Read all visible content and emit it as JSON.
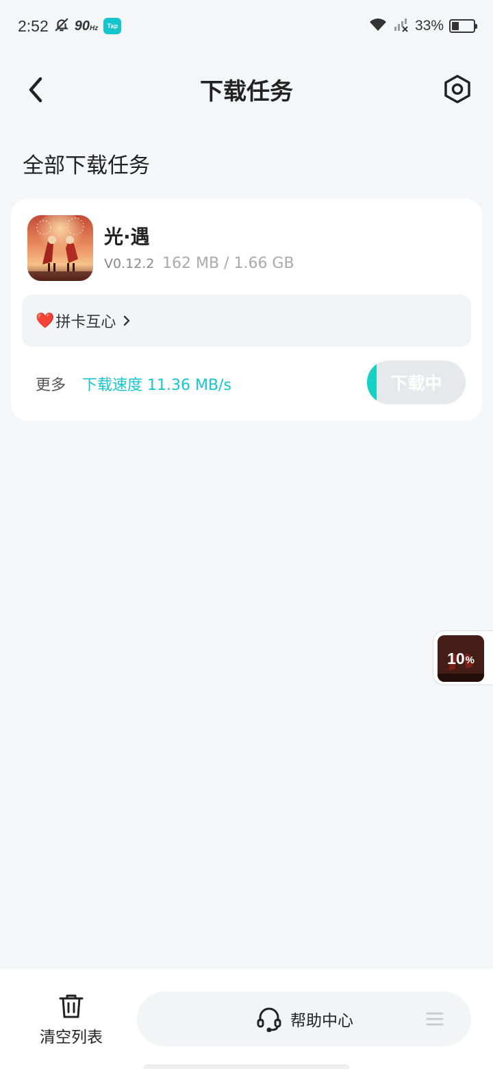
{
  "status_bar": {
    "time": "2:52",
    "refresh_rate": "90",
    "refresh_unit": "Hz",
    "tap_badge": "Tap",
    "battery_percent": "33%",
    "battery_level": 0.33,
    "icons": [
      "mute-bell-icon",
      "wifi-icon",
      "signal-off-icon",
      "battery-icon"
    ]
  },
  "header": {
    "title": "下载任务",
    "back_icon": "chevron-left-icon",
    "settings_icon": "settings-hexagon-icon"
  },
  "section_title": "全部下载任务",
  "task": {
    "app_name": "光·遇",
    "version": "V0.12.2",
    "size_progress": "162 MB / 1.66 GB",
    "promo": {
      "emoji": "❤️",
      "text": "拼卡互心"
    },
    "more_label": "更多",
    "speed_label": "下载速度 11.36 MB/s",
    "button_label": "下载中",
    "progress_fraction": 0.0976
  },
  "float_widget": {
    "percent_value": "10",
    "percent_sign": "%"
  },
  "bottom_bar": {
    "clear_label": "清空列表",
    "help_label": "帮助中心",
    "icons": [
      "trash-icon",
      "headset-icon",
      "menu-icon"
    ]
  },
  "colors": {
    "accent": "#15c5ce",
    "background": "#f5f6f8",
    "card": "#ffffff"
  }
}
